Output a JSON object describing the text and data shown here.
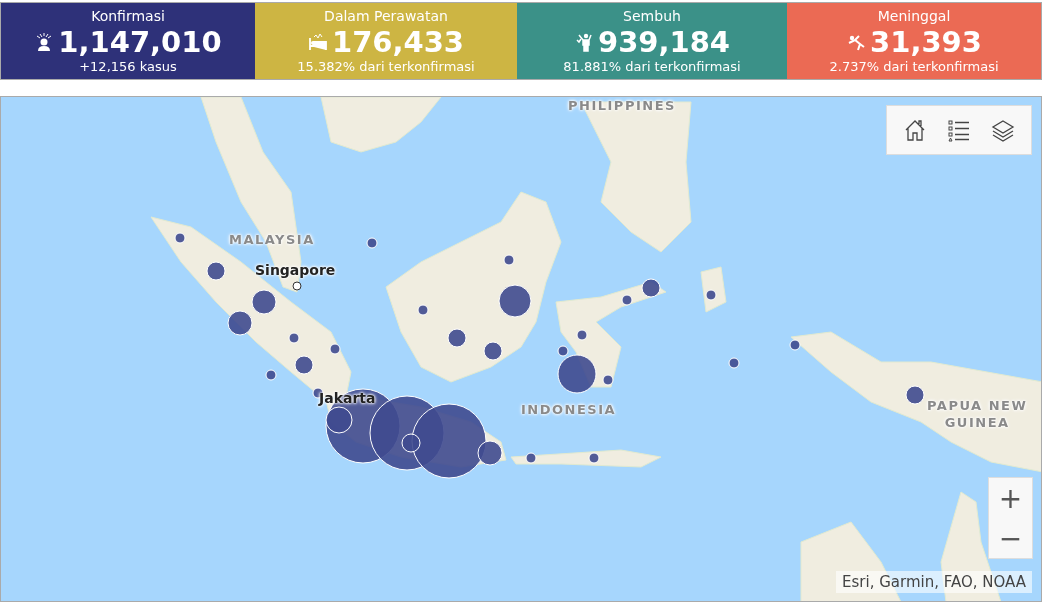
{
  "stats": [
    {
      "kind": "confirmed",
      "label": "Konfirmasi",
      "value": "1,147,010",
      "note": "+12,156 kasus",
      "color": "#2e3179"
    },
    {
      "kind": "treated",
      "label": "Dalam Perawatan",
      "value": "176,433",
      "note": "15.382% dari terkonfirmasi",
      "color": "#cdb543"
    },
    {
      "kind": "recovered",
      "label": "Sembuh",
      "value": "939,184",
      "note": "81.881% dari terkonfirmasi",
      "color": "#3b9188"
    },
    {
      "kind": "died",
      "label": "Meninggal",
      "value": "31,393",
      "note": "2.737% dari terkonfirmasi",
      "color": "#eb6a54"
    }
  ],
  "map": {
    "labels": [
      {
        "kind": "country",
        "text": "PHILIPPINES"
      },
      {
        "kind": "country",
        "text": "MALAYSIA"
      },
      {
        "kind": "city",
        "text": "Singapore"
      },
      {
        "kind": "city",
        "text": "Jakarta"
      },
      {
        "kind": "country",
        "text": "INDONESIA"
      },
      {
        "kind": "country",
        "text": "PAPUA NEW\nGUINEA"
      }
    ],
    "zoom_in": "+",
    "zoom_out": "−",
    "attribution": "Esri, Garmin, FAO, NOAA"
  }
}
